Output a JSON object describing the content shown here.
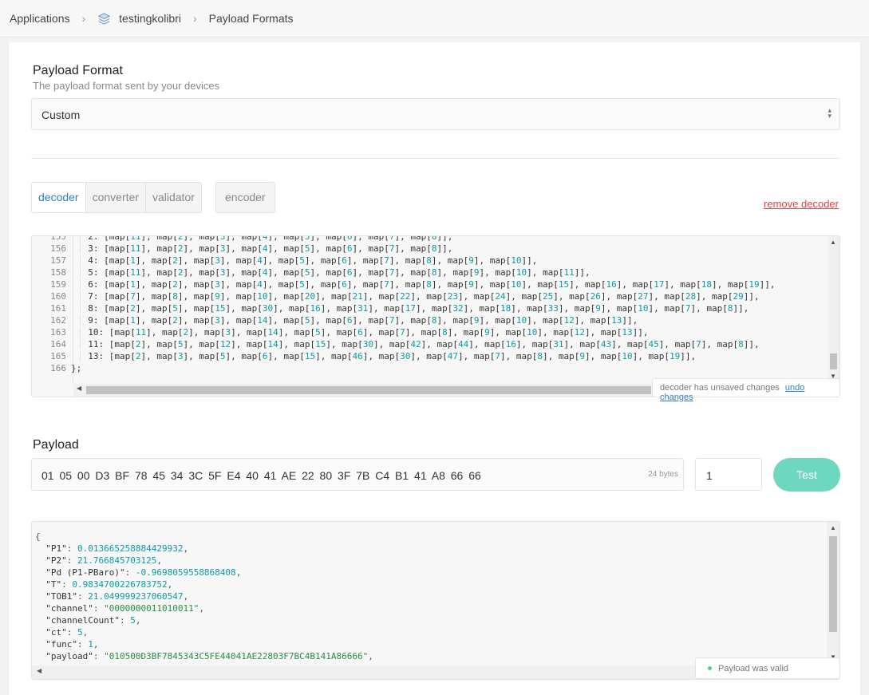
{
  "breadcrumb": {
    "root": "Applications",
    "app": "testingkolibri",
    "page": "Payload Formats",
    "app_icon": "stack-icon"
  },
  "format": {
    "title": "Payload Format",
    "subtitle": "The payload format sent by your devices",
    "selected": "Custom"
  },
  "tabs": {
    "decoder": "decoder",
    "converter": "converter",
    "validator": "validator",
    "encoder": "encoder",
    "active": "decoder"
  },
  "remove_decoder": "remove decoder",
  "editor": {
    "lines": [
      {
        "n": "155",
        "indent": true,
        "key": "2:",
        "maps": [
          "11",
          "2",
          "3",
          "4",
          "5",
          "6",
          "7",
          "8"
        ]
      },
      {
        "n": "156",
        "indent": true,
        "key": "3:",
        "maps": [
          "11",
          "2",
          "3",
          "4",
          "5",
          "6",
          "7",
          "8"
        ]
      },
      {
        "n": "157",
        "indent": true,
        "key": "4:",
        "maps": [
          "1",
          "2",
          "3",
          "4",
          "5",
          "6",
          "7",
          "8",
          "9",
          "10"
        ]
      },
      {
        "n": "158",
        "indent": true,
        "key": "5:",
        "maps": [
          "11",
          "2",
          "3",
          "4",
          "5",
          "6",
          "7",
          "8",
          "9",
          "10",
          "11"
        ]
      },
      {
        "n": "159",
        "indent": true,
        "key": "6:",
        "maps": [
          "1",
          "2",
          "3",
          "4",
          "5",
          "6",
          "7",
          "8",
          "9",
          "10",
          "15",
          "16",
          "17",
          "18",
          "19"
        ]
      },
      {
        "n": "160",
        "indent": true,
        "key": "7:",
        "maps": [
          "7",
          "8",
          "9",
          "10",
          "20",
          "21",
          "22",
          "23",
          "24",
          "25",
          "26",
          "27",
          "28",
          "29"
        ]
      },
      {
        "n": "161",
        "indent": true,
        "key": "8:",
        "maps": [
          "2",
          "5",
          "15",
          "30",
          "16",
          "31",
          "17",
          "32",
          "18",
          "33",
          "9",
          "10",
          "7",
          "8"
        ]
      },
      {
        "n": "162",
        "indent": true,
        "key": "9:",
        "maps": [
          "1",
          "2",
          "3",
          "14",
          "5",
          "6",
          "7",
          "8",
          "9",
          "10",
          "12",
          "13"
        ]
      },
      {
        "n": "163",
        "indent": true,
        "key": "10:",
        "maps": [
          "11",
          "2",
          "3",
          "14",
          "5",
          "6",
          "7",
          "8",
          "9",
          "10",
          "12",
          "13"
        ]
      },
      {
        "n": "164",
        "indent": true,
        "key": "11:",
        "maps": [
          "2",
          "5",
          "12",
          "14",
          "15",
          "30",
          "42",
          "44",
          "16",
          "31",
          "43",
          "45",
          "7",
          "8"
        ]
      },
      {
        "n": "165",
        "indent": true,
        "key": "13:",
        "maps": [
          "2",
          "3",
          "5",
          "6",
          "15",
          "46",
          "30",
          "47",
          "7",
          "8",
          "9",
          "10",
          "19"
        ]
      },
      {
        "n": "166",
        "indent": false,
        "key": "};",
        "maps": []
      }
    ],
    "unsaved_text": "decoder has unsaved changes",
    "undo_label": "undo changes"
  },
  "payload": {
    "title": "Payload",
    "value": "01 05 00 D3 BF 78 45 34 3C 5F E4 40 41 AE 22 80 3F 7B C4 B1 41 A8 66 66",
    "bytes": "24 bytes",
    "port": "1",
    "test_label": "Test"
  },
  "result": {
    "open": "{",
    "fields": [
      {
        "key": "\"P1\"",
        "value": "0.013665258884429932",
        "type": "n"
      },
      {
        "key": "\"P2\"",
        "value": "21.766845703125",
        "type": "n"
      },
      {
        "key": "\"Pd (P1-PBaro)\"",
        "value": "-0.9698059558868408",
        "type": "n"
      },
      {
        "key": "\"T\"",
        "value": "0.9834700226783752",
        "type": "n"
      },
      {
        "key": "\"TOB1\"",
        "value": "21.049999237060547",
        "type": "n"
      },
      {
        "key": "\"channel\"",
        "value": "\"0000000011010011\"",
        "type": "s"
      },
      {
        "key": "\"channelCount\"",
        "value": "5",
        "type": "n"
      },
      {
        "key": "\"ct\"",
        "value": "5",
        "type": "n"
      },
      {
        "key": "\"func\"",
        "value": "1",
        "type": "n"
      },
      {
        "key": "\"payload\"",
        "value": "\"010500D3BF7845343C5FE44041AE22803F7BC4B141A86666\"",
        "type": "s"
      }
    ],
    "valid_text": "Payload was valid"
  },
  "colors": {
    "accent": "#2f7ec1",
    "danger": "#e53e3e",
    "test_button": "#6fd6c0",
    "number": "#0a9aa8",
    "string": "#2a8c48",
    "valid_dot": "#4dd081"
  }
}
